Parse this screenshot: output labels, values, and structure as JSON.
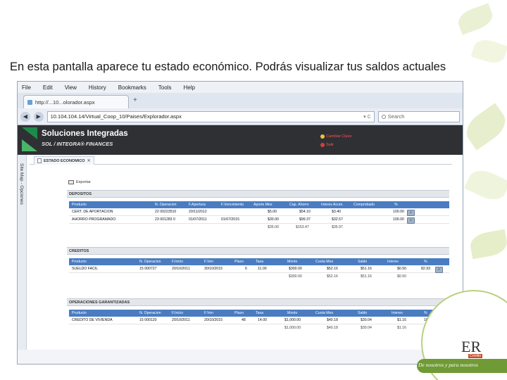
{
  "slide": {
    "caption": "En esta pantalla aparece tu estado económico. Podrás visualizar tus saldos actuales"
  },
  "browser": {
    "menu": [
      "File",
      "Edit",
      "View",
      "History",
      "Bookmarks",
      "Tools",
      "Help"
    ],
    "tab_title": "http://...10...olorador.aspx",
    "new_tab": "+",
    "back": "◀",
    "forward": "▶",
    "url": "10.104.104.14/Virtual_Coop_10/Paises/Explorador.aspx",
    "url_tools": "▾ C",
    "search_placeholder": "Search"
  },
  "app": {
    "brand": "Soluciones Integradas",
    "brand_sub": "SOL / INTEGRA® FINANCES",
    "link_password": "Cambiar Clave",
    "link_exit": "Salir",
    "side_label": "Site Map - Opciones",
    "active_tab": "ESTADO ECONOMICO",
    "export_label": "Exportar"
  },
  "depositos": {
    "title": "DEPOSITOS",
    "headers": [
      "Producto",
      "N. Operacion",
      "F.Apertura",
      "F.Vencimiento",
      "Aporte Mes",
      "Cap. Ahorro",
      "Interes Acum.",
      "Comprobado",
      "%"
    ],
    "rows": [
      [
        "CERT. DE APORTACION",
        "22 00223510",
        "20/11/2012",
        "",
        "$5.00",
        "$54.10",
        "$3.40",
        "",
        "100.00"
      ],
      [
        "AHORRO PROGRAMADO",
        "23 001283 0",
        "01/07/2011",
        "01/07/2015",
        "$30.00",
        "$99.37",
        "$32.57",
        "",
        "100.00"
      ]
    ],
    "totals": [
      "$35.00",
      "$153.47",
      "$35.97"
    ]
  },
  "creditos": {
    "title": "CREDITOS",
    "headers": [
      "Producto",
      "N. Operacion",
      "F.Inicio",
      "F.Ven",
      "Plazo",
      "Tasa",
      "Monto",
      "Cuota Mes",
      "Saldo",
      "Interes",
      "%"
    ],
    "rows": [
      [
        "SUELDO FACIL",
        "15 000727",
        "20/10/2011",
        "30/10/2015",
        "6",
        "11.00",
        "$300.00",
        "$52.16",
        "$51.16",
        "$0.50",
        "82.93"
      ]
    ],
    "totals": [
      "$300.00",
      "$52.16",
      "$51.16",
      "$0.50"
    ]
  },
  "garantizadas": {
    "title": "OPERACIONES GARANTIZADAS",
    "headers": [
      "Producto",
      "N. Operacion",
      "F.Inicio",
      "F.Ven",
      "Plazo",
      "Tasa",
      "Monto",
      "Cuota Mes",
      "Saldo",
      "Interes",
      "%"
    ],
    "rows": [
      [
        "CREDITO DE VIVIENDA",
        "15 000120",
        "20/10/2011",
        "20/10/2015",
        "48",
        "14.00",
        "$1,000.00",
        "$40.18",
        "$30.04",
        "$1.16",
        "100"
      ]
    ],
    "totals": [
      "$1,000.00",
      "$40.18",
      "$30.04",
      "$1.16"
    ]
  },
  "partner": {
    "mark": "ER",
    "tagline": "De nosotros y para nosotros",
    "tag": "Crédito"
  },
  "colors": {
    "grid_header": "#4a7cc2",
    "app_header": "#2f3034",
    "brand_green": "#1d8a4a",
    "link_red": "#ff5050"
  }
}
